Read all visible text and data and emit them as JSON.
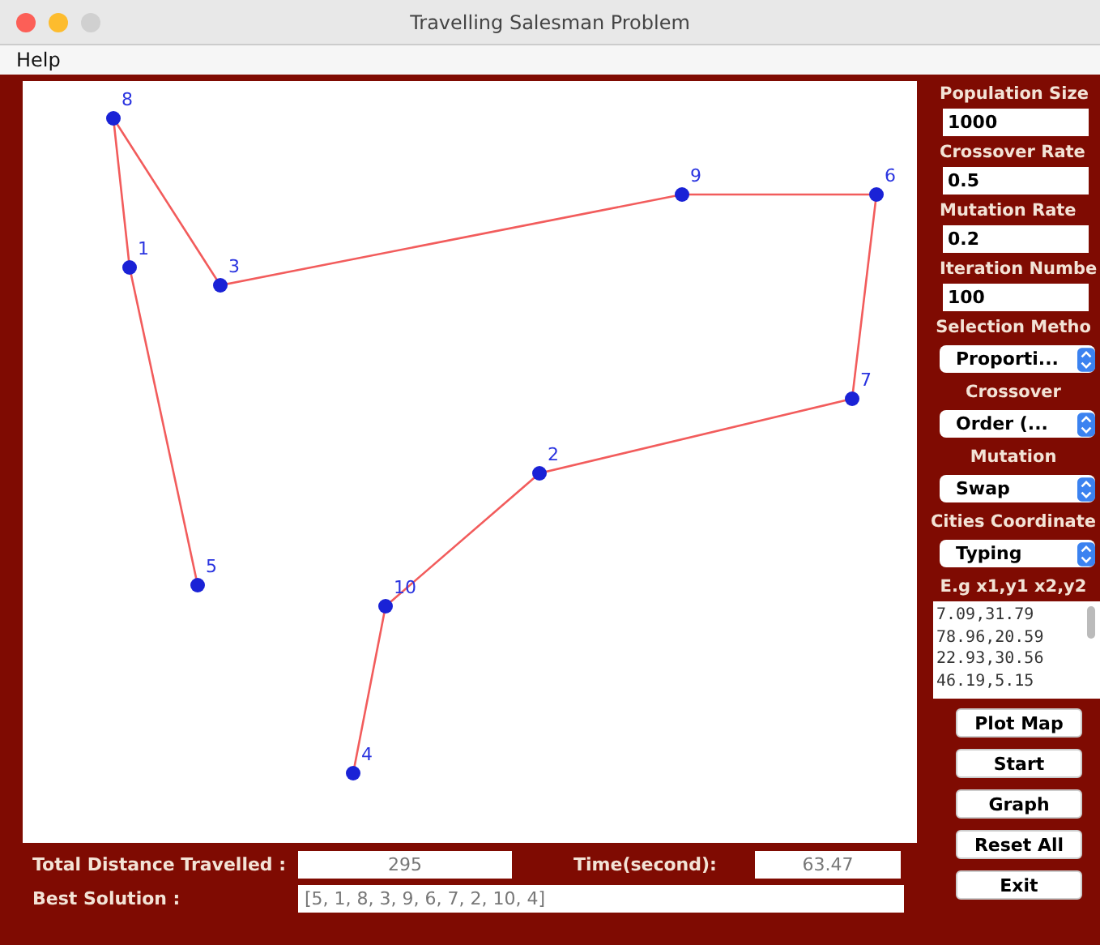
{
  "window": {
    "title": "Travelling Salesman Problem"
  },
  "menu": [
    "Help"
  ],
  "map": {
    "cities": [
      {
        "label": "5"
      },
      {
        "label": "1"
      },
      {
        "label": "8"
      },
      {
        "label": "3"
      },
      {
        "label": "9"
      },
      {
        "label": "6"
      },
      {
        "label": "7"
      },
      {
        "label": "2"
      },
      {
        "label": "10"
      },
      {
        "label": "4"
      }
    ]
  },
  "settings": [
    {
      "kind": "input",
      "label": "Population Size",
      "value": "1000"
    },
    {
      "kind": "input",
      "label": "Crossover Rate",
      "value": "0.5"
    },
    {
      "kind": "input",
      "label": "Mutation Rate",
      "value": "0.2"
    },
    {
      "kind": "input",
      "label": "Iteration Numbe",
      "value": "100"
    },
    {
      "kind": "select",
      "label": "Selection Metho",
      "value": "Proporti..."
    },
    {
      "kind": "select",
      "label": "Crossover",
      "value": "Order (..."
    },
    {
      "kind": "select",
      "label": "Mutation",
      "value": "Swap"
    },
    {
      "kind": "select",
      "label": "Cities Coordinate",
      "value": "Typing"
    }
  ],
  "coordinates": {
    "label": "E.g x1,y1  x2,y2",
    "lines": [
      "7.09,31.79",
      "78.96,20.59",
      "22.93,30.56",
      "46.19,5.15"
    ]
  },
  "buttons": [
    "Plot Map",
    "Start",
    "Graph",
    "Reset All",
    "Exit"
  ],
  "results": {
    "distance_label": "Total Distance Travelled :",
    "distance": "295",
    "time_label": "Time(second):",
    "time": "63.47",
    "solution_label": "Best Solution :",
    "solution": "[5, 1, 8, 3, 9, 6, 7, 2, 10, 4]"
  }
}
